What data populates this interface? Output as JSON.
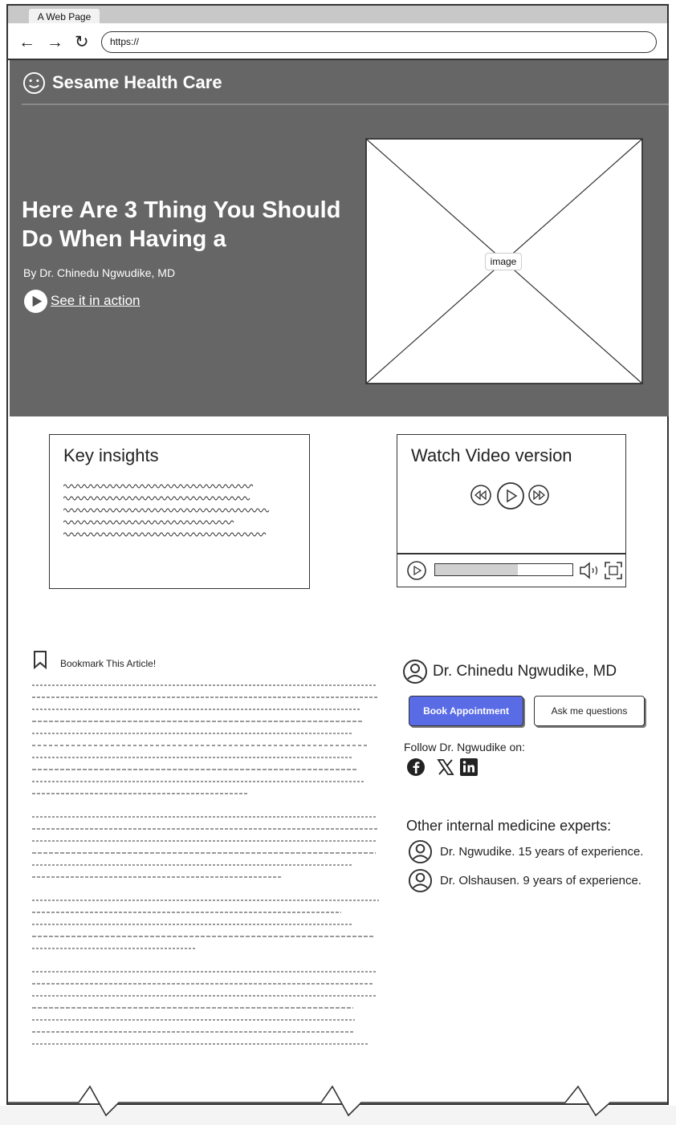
{
  "browser": {
    "tab_title": "A Web Page",
    "url": "https://"
  },
  "site": {
    "name": "Sesame Health Care"
  },
  "hero": {
    "title": "Here Are 3 Thing You Should Do When Having a",
    "author": "By Dr. Chinedu Ngwudike, MD",
    "cta_label": "See it in action",
    "image_label": "image"
  },
  "insights": {
    "title": "Key insights"
  },
  "video": {
    "title": "Watch Video version",
    "progress": 0.6
  },
  "article": {
    "bookmark_label": "Bookmark This Article!"
  },
  "doctor": {
    "name": "Dr. Chinedu Ngwudike, MD",
    "book_label": "Book Appointment",
    "ask_label": "Ask me questions",
    "follow_label": "Follow Dr. Ngwudike on:",
    "social": [
      "facebook-icon",
      "x-icon",
      "linkedin-icon"
    ]
  },
  "experts": {
    "title": "Other internal medicine experts:",
    "items": [
      {
        "label": "Dr. Ngwudike. 15 years of experience."
      },
      {
        "label": "Dr. Olshausen. 9 years of experience."
      }
    ]
  }
}
